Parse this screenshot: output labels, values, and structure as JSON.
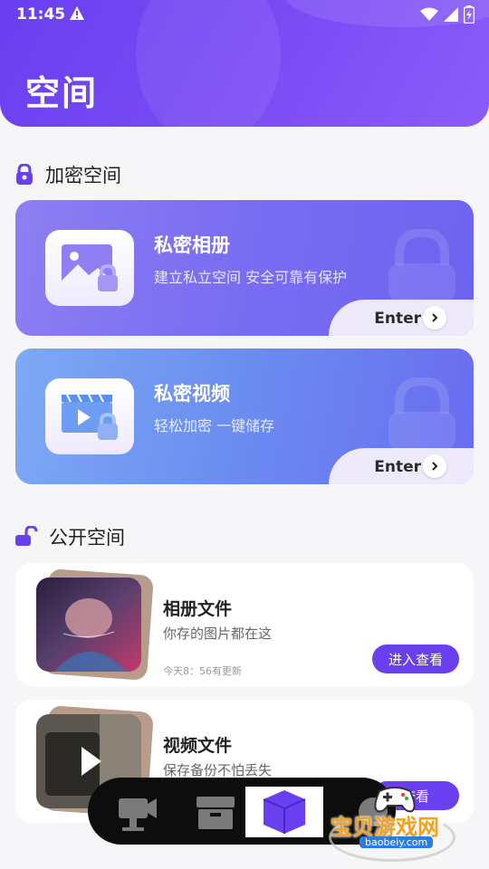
{
  "status_bar": {
    "time": "11:45"
  },
  "header": {
    "title": "空间"
  },
  "encrypted_section": {
    "title": "加密空间",
    "cards": [
      {
        "title": "私密相册",
        "subtitle": "建立私立空间 安全可靠有保护",
        "enter_label": "Enter"
      },
      {
        "title": "私密视频",
        "subtitle": "轻松加密 一键储存",
        "enter_label": "Enter"
      }
    ]
  },
  "public_section": {
    "title": "公开空间",
    "items": [
      {
        "title": "相册文件",
        "subtitle": "你存的图片都在这",
        "meta": "今天8：56有更新",
        "button": "进入查看"
      },
      {
        "title": "视频文件",
        "subtitle": "保存备份不怕丢失",
        "button": "查看"
      }
    ]
  },
  "dock": {
    "items": [
      {
        "icon": "camera-icon"
      },
      {
        "icon": "box-icon"
      },
      {
        "icon": "cube-icon",
        "active": true
      },
      {
        "icon": "circle-icon"
      }
    ]
  },
  "watermark": {
    "text": "宝贝游戏网",
    "url": "baobeiy.com"
  },
  "colors": {
    "brand": "#6a3ff0",
    "background": "#f6f6f8"
  }
}
